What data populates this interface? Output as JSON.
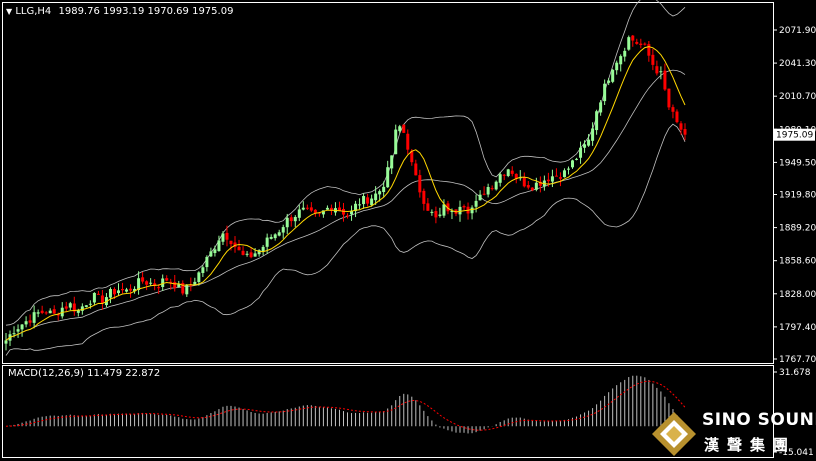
{
  "header": {
    "dropdown_glyph": "▼",
    "symbol_period": "LLG,H4",
    "ohlc": "1989.76 1993.19 1970.69 1975.09"
  },
  "price_axis": {
    "ticks": [
      "2071.90",
      "2041.30",
      "2010.70",
      "1980.10",
      "1949.50",
      "1919.80",
      "1889.20",
      "1858.60",
      "1828.00",
      "1797.40",
      "1767.70"
    ],
    "current_price": "1975.09"
  },
  "macd": {
    "label": "MACD(12,26,9) 11.479 22.872",
    "axis_ticks": [
      "31.678",
      "-15.041"
    ]
  },
  "logo": {
    "english": "SINO SOUND",
    "chinese": "漢聲集團"
  },
  "colors": {
    "background": "#000000",
    "bull_candle": "#98fb98",
    "bear_candle": "#ff0000",
    "bands": "#c0c0c0",
    "moving_average": "#ffd700",
    "macd_hist": "#c0c0c0",
    "macd_signal": "#ff0000"
  },
  "chart_data": [
    {
      "type": "candlestick",
      "title": "LLG,H4",
      "ylim": [
        1767.7,
        2080
      ],
      "close_path": [
        1785,
        1795,
        1800,
        1805,
        1810,
        1812,
        1808,
        1815,
        1818,
        1812,
        1820,
        1825,
        1822,
        1828,
        1832,
        1830,
        1835,
        1840,
        1838,
        1836,
        1842,
        1838,
        1830,
        1835,
        1845,
        1858,
        1870,
        1885,
        1880,
        1868,
        1860,
        1865,
        1870,
        1880,
        1885,
        1895,
        1900,
        1905,
        1902,
        1898,
        1906,
        1910,
        1905,
        1900,
        1912,
        1915,
        1918,
        1925,
        1945,
        1985,
        1975,
        1940,
        1920,
        1905,
        1895,
        1910,
        1900,
        1915,
        1905,
        1912,
        1925,
        1930,
        1940,
        1945,
        1935,
        1930,
        1928,
        1932,
        1936,
        1938,
        1940,
        1950,
        1960,
        1970,
        2000,
        2020,
        2040,
        2050,
        2065,
        2060,
        2055,
        2040,
        2030,
        2000,
        1985,
        1975.09
      ],
      "bollinger": true,
      "moving_average": true
    },
    {
      "type": "bar",
      "title": "MACD(12,26,9)",
      "macd_main": 11.479,
      "macd_signal": 22.872,
      "ylim": [
        -15.041,
        31.678
      ]
    }
  ]
}
